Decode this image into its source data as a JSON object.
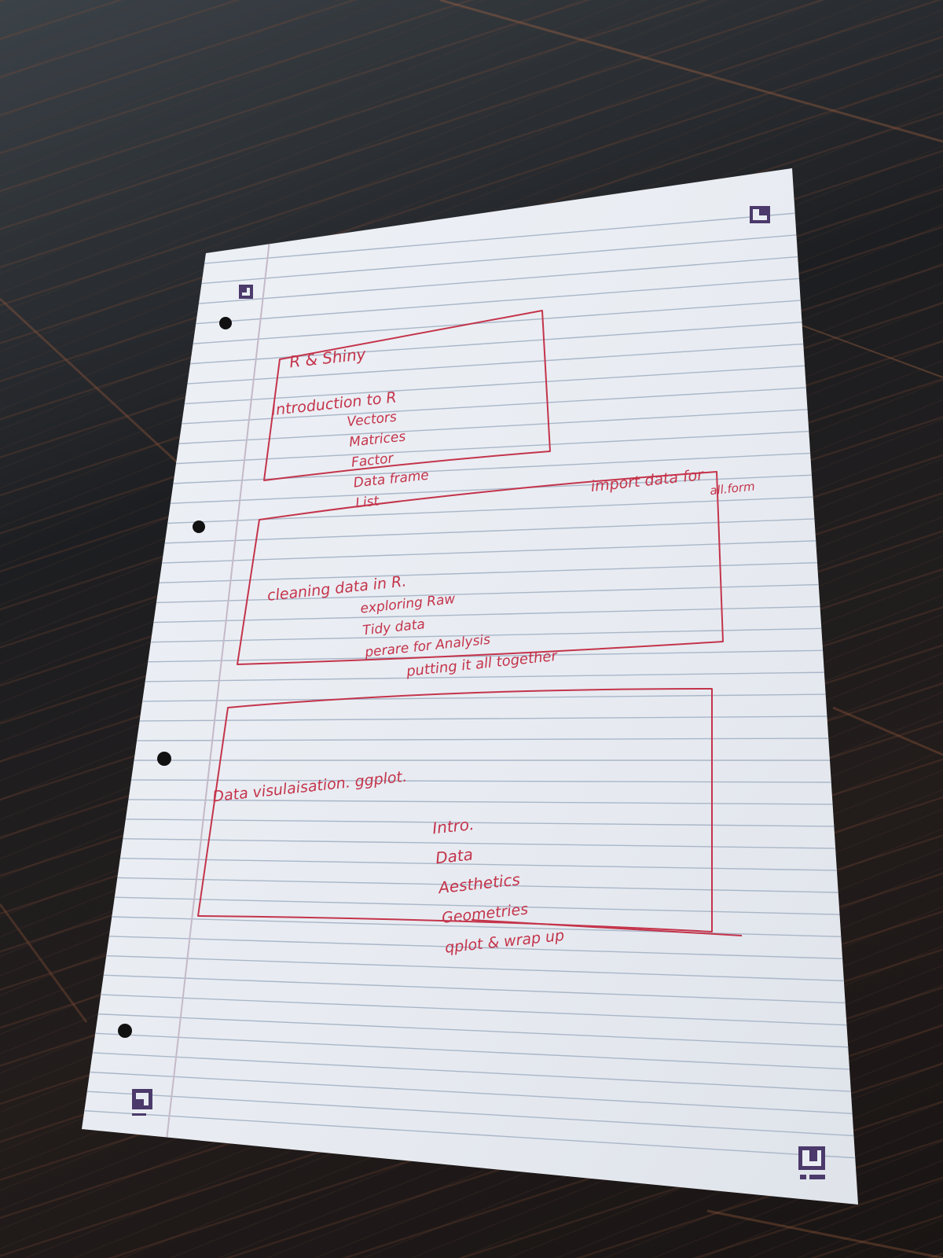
{
  "scene": {
    "description_free": true,
    "colors": {
      "desk": "#1d1e21",
      "paper": "#e9edf3",
      "rule_line": "#a9b6c8",
      "margin_line": "#c5b9c9",
      "ink": "#c4344b",
      "corner_marker": "#4b3a6b"
    }
  },
  "notes": {
    "title": "R & Shiny",
    "side_note": {
      "line1": "import data for",
      "line2": "all.form"
    },
    "sections": [
      {
        "heading": "Introduction to R",
        "items": [
          "Vectors",
          "Matrices",
          "Factor",
          "Data frame",
          "List"
        ]
      },
      {
        "heading": "cleaning data in R.",
        "items": [
          "exploring Raw",
          "Tidy data",
          "perare for Analysis",
          "putting it all together"
        ]
      },
      {
        "heading": "Data visulaisation. ggplot.",
        "items": [
          "Intro.",
          "Data",
          "Aesthetics",
          "Geometries",
          "qplot & wrap up"
        ]
      }
    ]
  }
}
